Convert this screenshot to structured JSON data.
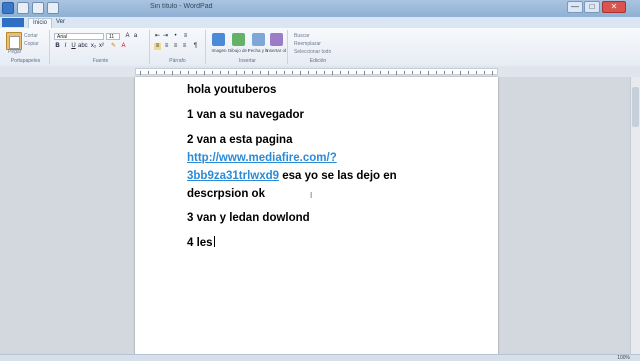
{
  "window": {
    "title": "Sin título - WordPad",
    "controls": [
      "—",
      "□",
      "✕"
    ]
  },
  "tabs": {
    "file": "",
    "home": "Inicio",
    "view": "Ver"
  },
  "ribbon": {
    "clipboard": {
      "paste": "Pegar",
      "cut": "Cortar",
      "copy": "Copiar",
      "label": "Portapapeles"
    },
    "font": {
      "family": "Arial",
      "size": "11",
      "label": "Fuente"
    },
    "paragraph": {
      "label": "Párrafo"
    },
    "insert": {
      "label": "Insertar",
      "items": [
        {
          "name": "Imagen",
          "color": "#4b8ad6"
        },
        {
          "name": "Dibujo de Paint",
          "color": "#66b16a"
        },
        {
          "name": "Fecha y hora",
          "color": "#7ea6d6"
        },
        {
          "name": "Insertar objeto",
          "color": "#9a7dc6"
        }
      ]
    },
    "editing": {
      "find": "Buscar",
      "replace": "Reemplazar",
      "select_all": "Seleccionar todo",
      "label": "Edición"
    }
  },
  "document": {
    "line1": "hola youtuberos",
    "line2": "1 van a su navegador",
    "line3": "2 van a esta pagina",
    "link_part1": "http://www.mediafire.com/?",
    "link_part2": "3bb9za31trlwxd9",
    "line4_rest": " esa yo se las dejo en",
    "line5": "descrpsion ok",
    "line6": "3 van y ledan dowlond",
    "line7": "4 les"
  },
  "statusbar": {
    "zoom": "100%"
  },
  "colors": {
    "link": "#2b8bd8",
    "titlebar": "#aac4e0"
  }
}
